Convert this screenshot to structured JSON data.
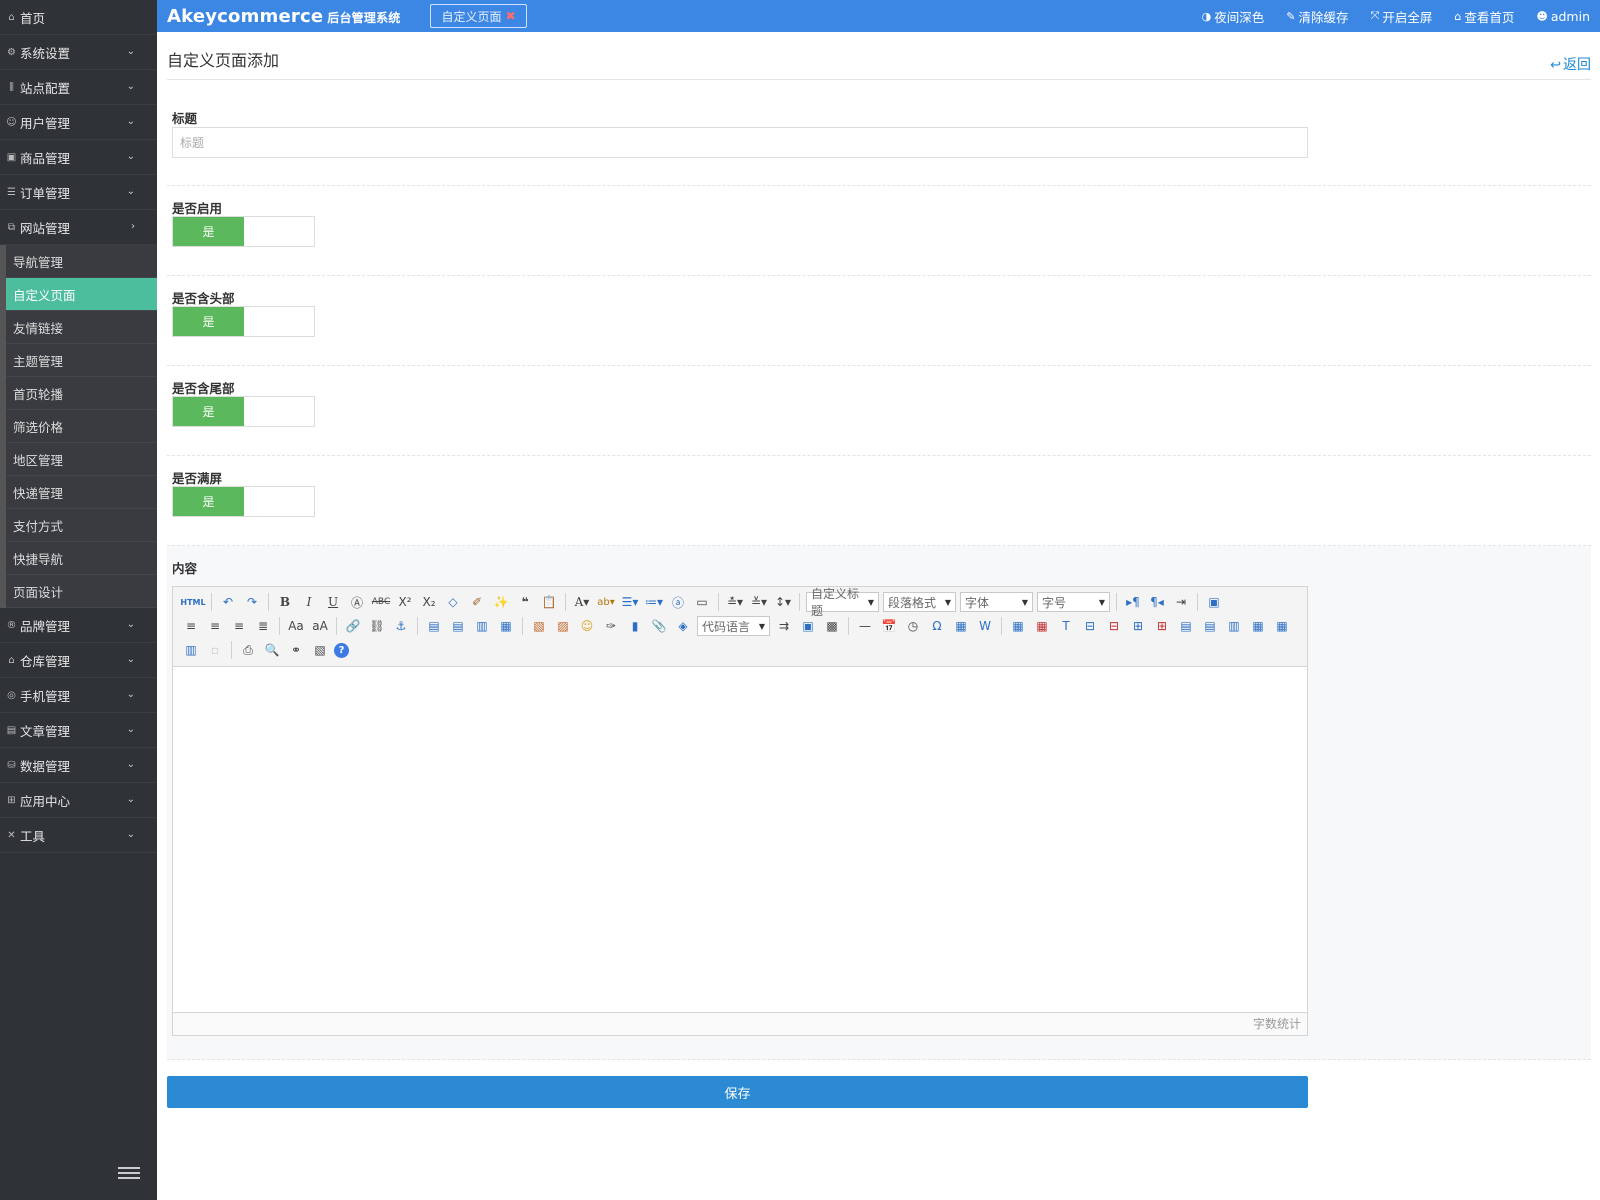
{
  "sidebar": {
    "home": "首页",
    "groups": [
      {
        "label": "系统设置",
        "icon": "gear-icon"
      },
      {
        "label": "站点配置",
        "icon": "sliders-icon"
      },
      {
        "label": "用户管理",
        "icon": "user-icon"
      },
      {
        "label": "商品管理",
        "icon": "box-icon"
      },
      {
        "label": "订单管理",
        "icon": "list-icon"
      },
      {
        "label": "网站管理",
        "icon": "web-icon"
      }
    ],
    "sub_items": [
      "导航管理",
      "自定义页面",
      "友情链接",
      "主题管理",
      "首页轮播",
      "筛选价格",
      "地区管理",
      "快递管理",
      "支付方式",
      "快捷导航",
      "页面设计"
    ],
    "active_sub": "自定义页面",
    "groups_after": [
      {
        "label": "品牌管理",
        "icon": "brand-icon"
      },
      {
        "label": "仓库管理",
        "icon": "warehouse-icon"
      },
      {
        "label": "手机管理",
        "icon": "phone-icon"
      },
      {
        "label": "文章管理",
        "icon": "article-icon"
      },
      {
        "label": "数据管理",
        "icon": "database-icon"
      },
      {
        "label": "应用中心",
        "icon": "apps-icon"
      },
      {
        "label": "工具",
        "icon": "tools-icon"
      }
    ]
  },
  "topbar": {
    "brand": "Akeycommerce",
    "brand_sub": "后台管理系统",
    "tab": "自定义页面",
    "nav": [
      {
        "label": "夜间深色",
        "icon": "contrast-icon"
      },
      {
        "label": "清除缓存",
        "icon": "brush-icon"
      },
      {
        "label": "开启全屏",
        "icon": "fullscreen-icon"
      },
      {
        "label": "查看首页",
        "icon": "home-icon"
      },
      {
        "label": "admin",
        "icon": "user-icon"
      }
    ]
  },
  "page": {
    "title": "自定义页面添加",
    "back": "返回"
  },
  "form": {
    "title_label": "标题",
    "title_placeholder": "标题",
    "enable_label": "是否启用",
    "header_label": "是否含头部",
    "footer_label": "是否含尾部",
    "fullscreen_label": "是否满屏",
    "yes": "是",
    "content_label": "内容",
    "save": "保存"
  },
  "editor": {
    "html_btn": "HTML",
    "custom_title": "自定义标题",
    "paragraph": "段落格式",
    "font": "字体",
    "font_size": "字号",
    "code_lang": "代码语言",
    "word_count": "字数统计"
  }
}
